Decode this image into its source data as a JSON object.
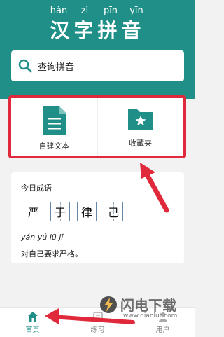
{
  "header": {
    "pinyin": [
      "hàn",
      "zì",
      "pīn",
      "yīn"
    ],
    "title": [
      "汉",
      "字",
      "拼",
      "音"
    ]
  },
  "search": {
    "placeholder": "查询拼音",
    "icon": "search-icon"
  },
  "quick_actions": {
    "items": [
      {
        "label": "自建文本",
        "icon": "document-icon"
      },
      {
        "label": "收藏夹",
        "icon": "star-folder-icon"
      }
    ]
  },
  "idiom": {
    "title": "今日成语",
    "chars": [
      "严",
      "于",
      "律",
      "己"
    ],
    "pinyin": "yán yú lǜ jǐ",
    "definition": "对自己要求严格。"
  },
  "tabbar": {
    "items": [
      {
        "label": "首页",
        "icon": "home-icon"
      },
      {
        "label": "练习",
        "icon": "practice-icon"
      },
      {
        "label": "用户",
        "icon": "user-icon"
      }
    ]
  },
  "watermark": {
    "text": "闪电下载",
    "url": "www.dianlut.com"
  },
  "colors": {
    "primary": "#1f8f87",
    "highlight": "#e02a3b"
  }
}
